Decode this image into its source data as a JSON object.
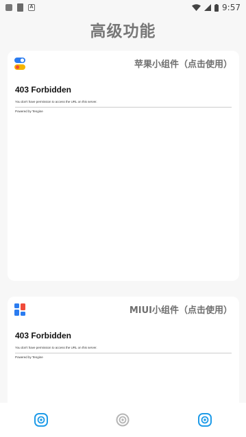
{
  "status_bar": {
    "time": "9:57"
  },
  "page_title": "高级功能",
  "cards": [
    {
      "title": "苹果小组件（点击使用）",
      "web": {
        "heading": "403 Forbidden",
        "message": "You don't have permission to access the URL on this server.",
        "powered": "Powered by Tengine"
      }
    },
    {
      "title": "MIUI小组件（点击使用）",
      "web": {
        "heading": "403 Forbidden",
        "message": "You don't have permission to access the URL on this server.",
        "powered": "Powered by Tengine"
      }
    }
  ],
  "bottom_nav": {
    "items": [
      "target-icon",
      "target-icon",
      "target-icon"
    ],
    "active_color": "#1e9be8",
    "inactive_color": "#b5b5b5"
  },
  "colors": {
    "accent_blue": "#2b7cf0",
    "accent_red": "#f04b3a",
    "accent_yellow": "#f5b400"
  }
}
